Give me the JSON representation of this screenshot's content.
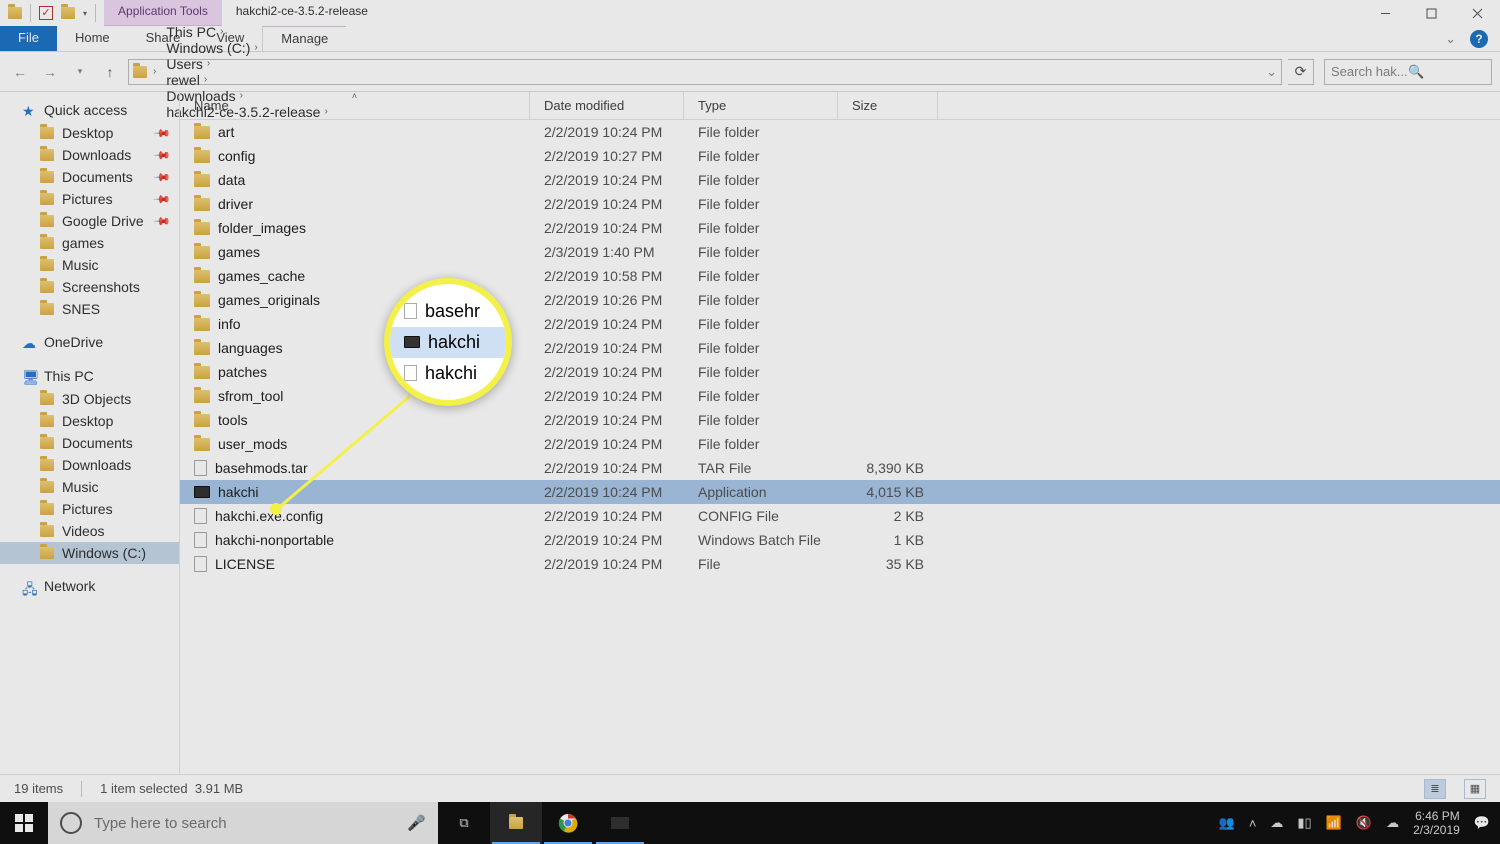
{
  "window": {
    "tool_tab": "Application Tools",
    "title": "hakchi2-ce-3.5.2-release"
  },
  "ribbon": {
    "file": "File",
    "tabs": [
      "Home",
      "Share",
      "View"
    ],
    "manage": "Manage"
  },
  "breadcrumb": [
    "This PC",
    "Windows (C:)",
    "Users",
    "rewel",
    "Downloads",
    "hakchi2-ce-3.5.2-release"
  ],
  "search_placeholder": "Search hak...",
  "columns": {
    "name": "Name",
    "date": "Date modified",
    "type": "Type",
    "size": "Size"
  },
  "sidebar": {
    "quick_access": {
      "label": "Quick access",
      "items": [
        {
          "label": "Desktop",
          "pinned": true
        },
        {
          "label": "Downloads",
          "pinned": true
        },
        {
          "label": "Documents",
          "pinned": true
        },
        {
          "label": "Pictures",
          "pinned": true
        },
        {
          "label": "Google Drive",
          "pinned": true
        },
        {
          "label": "games",
          "pinned": false
        },
        {
          "label": "Music",
          "pinned": false
        },
        {
          "label": "Screenshots",
          "pinned": false
        },
        {
          "label": "SNES",
          "pinned": false
        }
      ]
    },
    "onedrive": {
      "label": "OneDrive"
    },
    "this_pc": {
      "label": "This PC",
      "items": [
        {
          "label": "3D Objects"
        },
        {
          "label": "Desktop"
        },
        {
          "label": "Documents"
        },
        {
          "label": "Downloads"
        },
        {
          "label": "Music"
        },
        {
          "label": "Pictures"
        },
        {
          "label": "Videos"
        },
        {
          "label": "Windows (C:)",
          "selected": true
        }
      ]
    },
    "network": {
      "label": "Network"
    }
  },
  "rows": [
    {
      "icon": "folder",
      "name": "art",
      "date": "2/2/2019 10:24 PM",
      "type": "File folder",
      "size": ""
    },
    {
      "icon": "folder",
      "name": "config",
      "date": "2/2/2019 10:27 PM",
      "type": "File folder",
      "size": ""
    },
    {
      "icon": "folder",
      "name": "data",
      "date": "2/2/2019 10:24 PM",
      "type": "File folder",
      "size": ""
    },
    {
      "icon": "folder",
      "name": "driver",
      "date": "2/2/2019 10:24 PM",
      "type": "File folder",
      "size": ""
    },
    {
      "icon": "folder",
      "name": "folder_images",
      "date": "2/2/2019 10:24 PM",
      "type": "File folder",
      "size": ""
    },
    {
      "icon": "folder",
      "name": "games",
      "date": "2/3/2019 1:40 PM",
      "type": "File folder",
      "size": ""
    },
    {
      "icon": "folder",
      "name": "games_cache",
      "date": "2/2/2019 10:58 PM",
      "type": "File folder",
      "size": ""
    },
    {
      "icon": "folder",
      "name": "games_originals",
      "date": "2/2/2019 10:26 PM",
      "type": "File folder",
      "size": ""
    },
    {
      "icon": "folder",
      "name": "info",
      "date": "2/2/2019 10:24 PM",
      "type": "File folder",
      "size": ""
    },
    {
      "icon": "folder",
      "name": "languages",
      "date": "2/2/2019 10:24 PM",
      "type": "File folder",
      "size": ""
    },
    {
      "icon": "folder",
      "name": "patches",
      "date": "2/2/2019 10:24 PM",
      "type": "File folder",
      "size": ""
    },
    {
      "icon": "folder",
      "name": "sfrom_tool",
      "date": "2/2/2019 10:24 PM",
      "type": "File folder",
      "size": ""
    },
    {
      "icon": "folder",
      "name": "tools",
      "date": "2/2/2019 10:24 PM",
      "type": "File folder",
      "size": ""
    },
    {
      "icon": "folder",
      "name": "user_mods",
      "date": "2/2/2019 10:24 PM",
      "type": "File folder",
      "size": ""
    },
    {
      "icon": "doc",
      "name": "basehmods.tar",
      "date": "2/2/2019 10:24 PM",
      "type": "TAR File",
      "size": "8,390 KB"
    },
    {
      "icon": "exe",
      "name": "hakchi",
      "date": "2/2/2019 10:24 PM",
      "type": "Application",
      "size": "4,015 KB",
      "selected": true
    },
    {
      "icon": "doc",
      "name": "hakchi.exe.config",
      "date": "2/2/2019 10:24 PM",
      "type": "CONFIG File",
      "size": "2 KB"
    },
    {
      "icon": "doc",
      "name": "hakchi-nonportable",
      "date": "2/2/2019 10:24 PM",
      "type": "Windows Batch File",
      "size": "1 KB"
    },
    {
      "icon": "doc",
      "name": "LICENSE",
      "date": "2/2/2019 10:24 PM",
      "type": "File",
      "size": "35 KB"
    }
  ],
  "status": {
    "count": "19 items",
    "selected": "1 item selected",
    "size": "3.91 MB"
  },
  "taskbar": {
    "search_placeholder": "Type here to search",
    "time": "6:46 PM",
    "date": "2/3/2019"
  },
  "callout": {
    "top": "basehr",
    "mid": "hakchi",
    "bot": "hakchi"
  }
}
